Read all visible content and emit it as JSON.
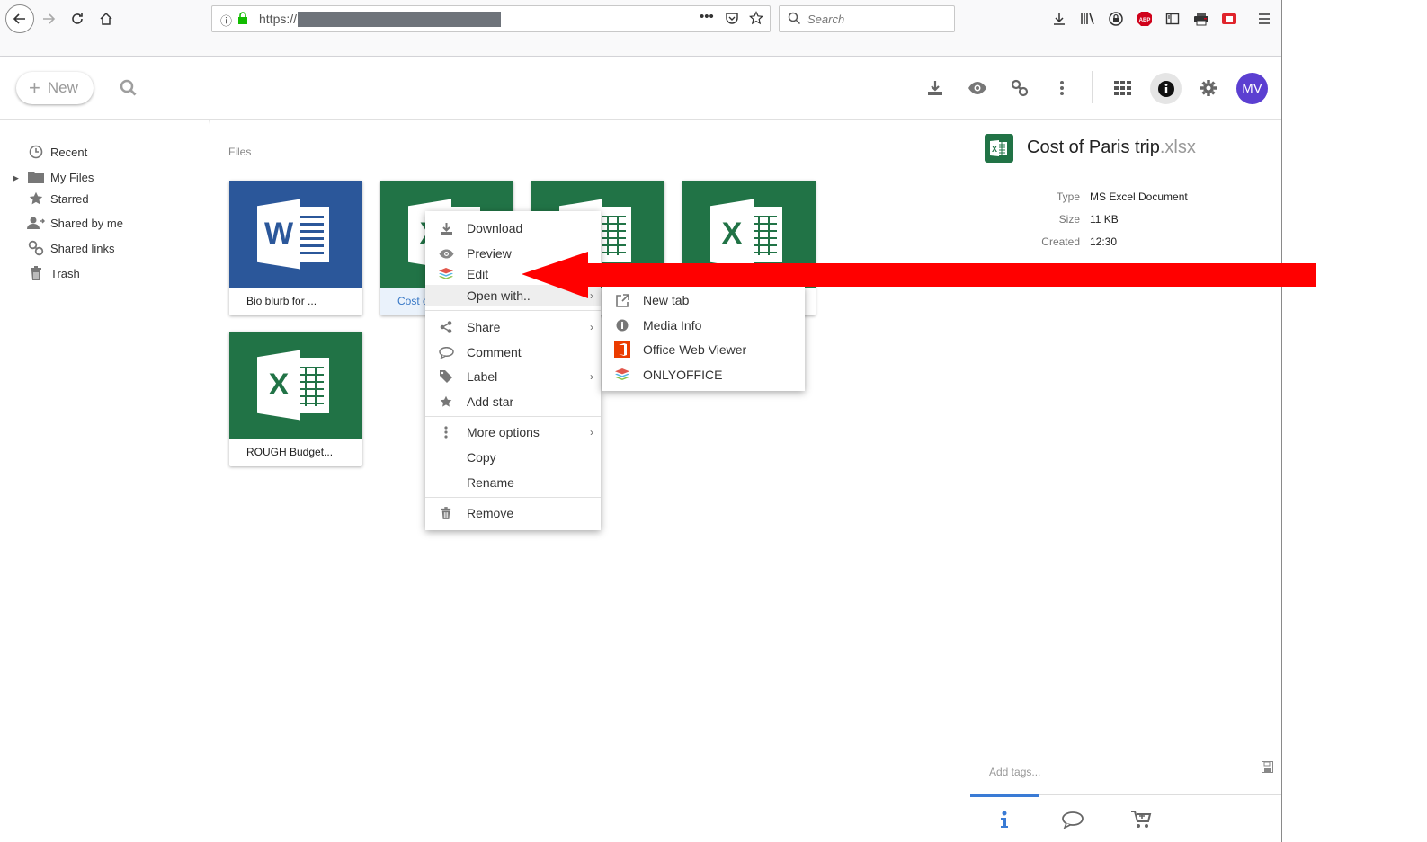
{
  "browser": {
    "url_prefix": "https://",
    "search_placeholder": "Search"
  },
  "header": {
    "new_label": "New",
    "avatar_initials": "MV"
  },
  "sidebar": {
    "items": [
      {
        "label": "Recent",
        "icon": "clock-icon"
      },
      {
        "label": "My Files",
        "icon": "folder-icon"
      },
      {
        "label": "Starred",
        "icon": "star-icon"
      },
      {
        "label": "Shared by me",
        "icon": "shared-user-icon"
      },
      {
        "label": "Shared links",
        "icon": "link-icon"
      },
      {
        "label": "Trash",
        "icon": "trash-icon"
      }
    ]
  },
  "main": {
    "breadcrumb": "Files",
    "files": [
      {
        "name": "Bio blurb for ...",
        "type": "word",
        "color": "#2b579a",
        "badge": "W"
      },
      {
        "name": "Cost o",
        "type": "excel",
        "color": "#217346",
        "badge": "X"
      },
      {
        "name": "",
        "type": "excel",
        "color": "#217346",
        "badge": "X"
      },
      {
        "name": "",
        "type": "excel",
        "color": "#217346",
        "badge": "X"
      },
      {
        "name": "ROUGH Budget...",
        "type": "excel",
        "color": "#217346",
        "badge": "X"
      }
    ]
  },
  "context_menu": {
    "items": [
      {
        "label": "Download",
        "icon": "download-icon"
      },
      {
        "label": "Preview",
        "icon": "eye-icon"
      },
      {
        "label": "Edit",
        "icon": "onlyoffice-icon"
      },
      {
        "label": "Open with..",
        "icon": "",
        "submenu": true
      },
      {
        "label": "Share",
        "icon": "share-icon",
        "submenu": true
      },
      {
        "label": "Comment",
        "icon": "comment-icon"
      },
      {
        "label": "Label",
        "icon": "tag-icon",
        "submenu": true
      },
      {
        "label": "Add star",
        "icon": "star-icon"
      },
      {
        "label": "More options",
        "icon": "dots-icon",
        "submenu": true
      },
      {
        "label": "Copy",
        "icon": ""
      },
      {
        "label": "Rename",
        "icon": ""
      },
      {
        "label": "Remove",
        "icon": "trash-icon"
      }
    ],
    "open_with": [
      {
        "label": "New tab",
        "icon": "external-link-icon"
      },
      {
        "label": "Media Info",
        "icon": "info-icon"
      },
      {
        "label": "Office Web Viewer",
        "icon": "office-icon"
      },
      {
        "label": "ONLYOFFICE",
        "icon": "onlyoffice-icon"
      }
    ]
  },
  "details": {
    "title_base": "Cost of Paris trip",
    "title_ext": ".xlsx",
    "props": [
      {
        "key": "Type",
        "value": "MS Excel Document"
      },
      {
        "key": "Size",
        "value": "11 KB"
      },
      {
        "key": "Created",
        "value": "12:30"
      }
    ],
    "tags_placeholder": "Add tags..."
  },
  "colors": {
    "annotation_arrow": "#ff0000",
    "excel_green": "#217346",
    "word_blue": "#2b579a",
    "avatar": "#5b3fd1"
  }
}
